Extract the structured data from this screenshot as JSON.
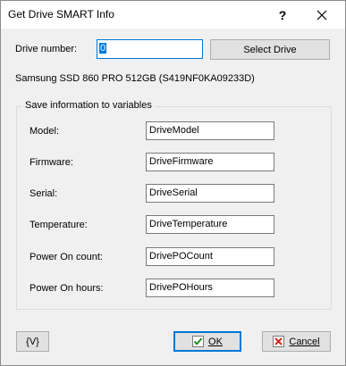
{
  "window": {
    "title": "Get Drive SMART Info",
    "help_glyph": "?"
  },
  "drive": {
    "number_label": "Drive number:",
    "number_value": "0",
    "select_button": "Select Drive",
    "description": "Samsung SSD 860 PRO 512GB (S419NF0KA09233D)"
  },
  "group": {
    "title": "Save information to variables",
    "fields": [
      {
        "label": "Model:",
        "value": "DriveModel"
      },
      {
        "label": "Firmware:",
        "value": "DriveFirmware"
      },
      {
        "label": "Serial:",
        "value": "DriveSerial"
      },
      {
        "label": "Temperature:",
        "value": "DriveTemperature"
      },
      {
        "label": "Power On count:",
        "value": "DrivePOCount"
      },
      {
        "label": "Power On hours:",
        "value": "DrivePOHours"
      }
    ]
  },
  "footer": {
    "var_button": "{V}",
    "ok_label": "OK",
    "cancel_label": "Cancel"
  },
  "colors": {
    "accent": "#0078d7",
    "ok_check": "#1e8f1e",
    "cancel_x": "#d9241c"
  }
}
